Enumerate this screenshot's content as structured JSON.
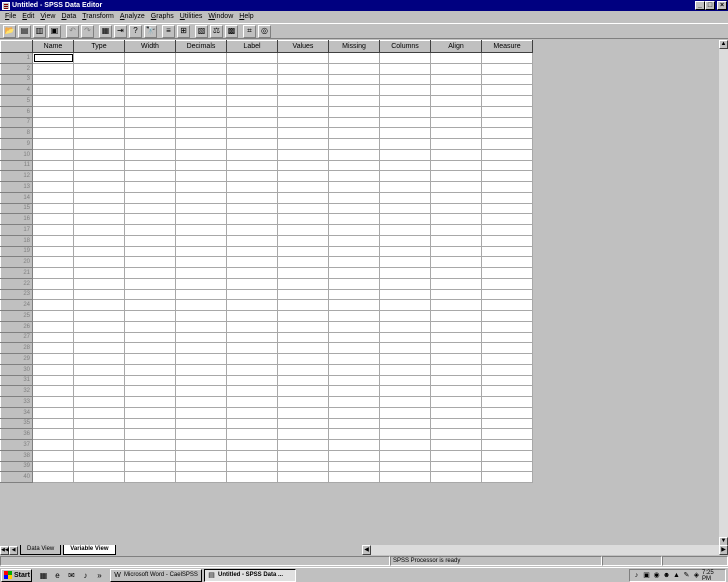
{
  "window": {
    "title": "Untitled - SPSS Data Editor",
    "controls": [
      "_",
      "□",
      "×"
    ]
  },
  "menubar": {
    "items": [
      {
        "label": "File",
        "name": "file"
      },
      {
        "label": "Edit",
        "name": "edit"
      },
      {
        "label": "View",
        "name": "view"
      },
      {
        "label": "Data",
        "name": "data"
      },
      {
        "label": "Transform",
        "name": "transform"
      },
      {
        "label": "Analyze",
        "name": "analyze"
      },
      {
        "label": "Graphs",
        "name": "graphs"
      },
      {
        "label": "Utilities",
        "name": "utilities"
      },
      {
        "label": "Window",
        "name": "window"
      },
      {
        "label": "Help",
        "name": "help"
      }
    ]
  },
  "toolbar": {
    "buttons": [
      {
        "name": "open-file-icon",
        "glyph": "📂",
        "enabled": true
      },
      {
        "name": "save-icon",
        "glyph": "▤",
        "enabled": true
      },
      {
        "name": "print-icon",
        "glyph": "▥",
        "enabled": true
      },
      {
        "name": "dialog-recall-icon",
        "glyph": "▣",
        "enabled": true
      },
      {
        "name": "undo-icon",
        "glyph": "↶",
        "enabled": false
      },
      {
        "name": "redo-icon",
        "glyph": "↷",
        "enabled": false
      },
      {
        "name": "goto-chart-icon",
        "glyph": "▦",
        "enabled": true
      },
      {
        "name": "goto-case-icon",
        "glyph": "⇥",
        "enabled": true
      },
      {
        "name": "variables-icon",
        "glyph": "?",
        "enabled": true
      },
      {
        "name": "find-icon",
        "glyph": "🔭",
        "enabled": true
      },
      {
        "name": "insert-case-icon",
        "glyph": "≡",
        "enabled": true
      },
      {
        "name": "insert-variable-icon",
        "glyph": "⊞",
        "enabled": true
      },
      {
        "name": "split-file-icon",
        "glyph": "▧",
        "enabled": true
      },
      {
        "name": "weight-cases-icon",
        "glyph": "⚖",
        "enabled": true
      },
      {
        "name": "select-cases-icon",
        "glyph": "▩",
        "enabled": true
      },
      {
        "name": "value-labels-icon",
        "glyph": "⌗",
        "enabled": true
      },
      {
        "name": "use-sets-icon",
        "glyph": "◎",
        "enabled": true
      }
    ]
  },
  "grid": {
    "columns": [
      "Name",
      "Type",
      "Width",
      "Decimals",
      "Label",
      "Values",
      "Missing",
      "Columns",
      "Align",
      "Measure"
    ],
    "rows": [
      "1",
      "2",
      "3",
      "4",
      "5",
      "6",
      "7",
      "8",
      "9",
      "10",
      "11",
      "12",
      "13",
      "14",
      "15",
      "16",
      "17",
      "18",
      "19",
      "20",
      "21",
      "22",
      "23",
      "24",
      "25",
      "26",
      "27",
      "28",
      "29",
      "30",
      "31",
      "32",
      "33",
      "34",
      "35",
      "36",
      "37",
      "38",
      "39",
      "40"
    ]
  },
  "sheet_tabs": {
    "nav": [
      "◀◀",
      "◀"
    ],
    "tabs": [
      {
        "label": "Data View",
        "active": false
      },
      {
        "label": "Variable View",
        "active": true
      }
    ]
  },
  "statusbar": {
    "message": "SPSS Processor  is ready"
  },
  "taskbar": {
    "start_label": "Start",
    "quick_launch": [
      {
        "name": "desktop-icon",
        "glyph": "▦"
      },
      {
        "name": "internet-explorer-icon",
        "glyph": "e"
      },
      {
        "name": "outlook-icon",
        "glyph": "✉"
      },
      {
        "name": "media-icon",
        "glyph": "♪"
      },
      {
        "name": "more-icon",
        "glyph": "»"
      }
    ],
    "tasks": [
      {
        "label": "Microsoft Word - CaelSPSS",
        "icon": "W",
        "active": false
      },
      {
        "label": "Untitled - SPSS Data ...",
        "icon": "▤",
        "active": true
      }
    ],
    "tray_icons": [
      "♪",
      "▣",
      "◉",
      "☻",
      "▲",
      "✎",
      "◈"
    ],
    "clock": "7:25 PM"
  }
}
